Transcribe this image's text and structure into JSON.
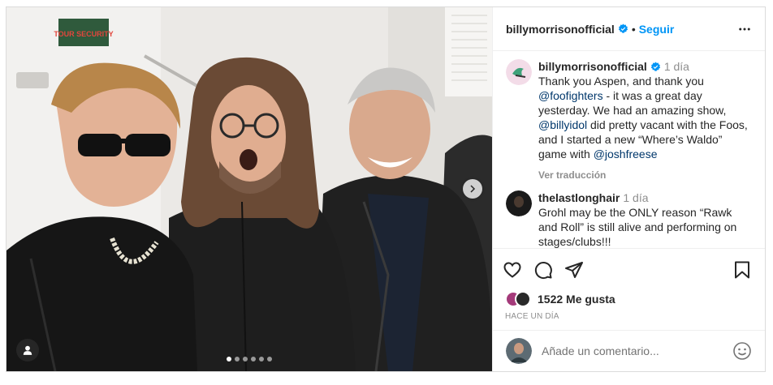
{
  "photo": {
    "sign_text": "TOUR SECURITY",
    "slide_count": 6,
    "active_slide": 1
  },
  "header": {
    "username": "billymorrisonofficial",
    "separator": "•",
    "follow_label": "Seguir"
  },
  "caption": {
    "username": "billymorrisonofficial",
    "time": "1 día",
    "text_1": "Thank you Aspen, and thank you ",
    "mention_1": "@foofighters",
    "text_2": " - it was a great day yesterday. We had an amazing show, ",
    "mention_2": "@billyidol",
    "text_3": " did pretty vacant with the Foos, and I started a new “Where’s Waldo” game with ",
    "mention_3": "@joshfreese",
    "translate_label": "Ver traducción"
  },
  "comment": {
    "username": "thelastlonghair",
    "time": "1 día",
    "text": "Grohl may be the ONLY reason “Rawk and Roll” is still alive and performing on stages/clubs!!!"
  },
  "actions": {
    "likes": "1522 Me gusta",
    "posted": "HACE UN DÍA"
  },
  "add_comment": {
    "placeholder": "Añade un comentario..."
  },
  "colors": {
    "accent": "#0095f6",
    "mention": "#00376b",
    "muted": "#8e8e8e",
    "border": "#dbdbdb"
  }
}
